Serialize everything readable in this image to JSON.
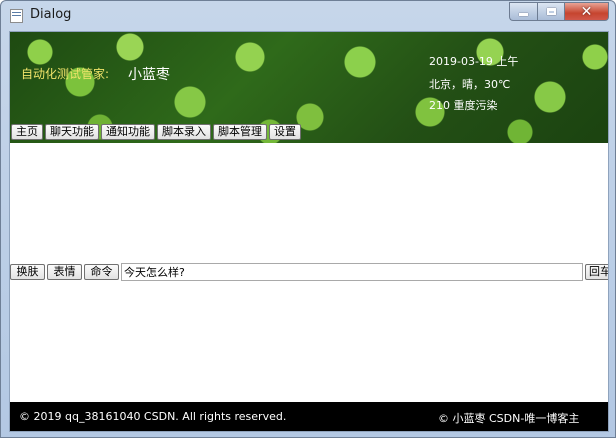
{
  "window": {
    "title": "Dialog"
  },
  "banner": {
    "brand_label": "自动化测试管家:",
    "brand_name": "小蓝枣",
    "date": "2019-03-19 上午",
    "weather": "北京，晴，30℃",
    "pollution": "210 重度污染"
  },
  "nav": {
    "items": [
      "主页",
      "聊天功能",
      "通知功能",
      "脚本录入",
      "脚本管理",
      "设置"
    ]
  },
  "input_row": {
    "skin_label": "换肤",
    "emoji_label": "表情",
    "command_label": "命令",
    "message_value": "今天怎么样?",
    "send_label": "回车"
  },
  "footer": {
    "left": "© 2019 qq_38161040 CSDN. All rights reserved.",
    "right": "© 小蓝枣 CSDN-唯一博客主"
  },
  "colors": {
    "brand_label": "#f0e36a",
    "footer_bg": "#000000",
    "close_button": "#c6452f"
  }
}
